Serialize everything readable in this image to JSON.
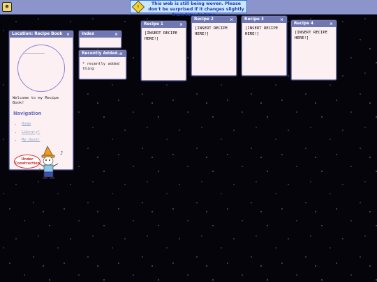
{
  "notice": {
    "icon": "warning-icon",
    "text": "This web is still being woven.  Please don't be surprised if it changes slightly from time to time..."
  },
  "location_window": {
    "title": "Location: Recipe Book",
    "welcome": "Welcome to my Recipe Book!",
    "nav_heading": "Navigation",
    "nav_items": [
      "Home",
      "Library!",
      "My Desk!"
    ],
    "badge_text": "Under Construction"
  },
  "index_window": {
    "title": "Index"
  },
  "recent_window": {
    "title": "Recently Added...",
    "items": [
      "* recently added thing"
    ]
  },
  "recipes": [
    {
      "title": "Recipe 1",
      "text": "[INSERT RECIPE HERE!]"
    },
    {
      "title": "Recipe 2",
      "text": "[INSERT RECIPE HERE!]"
    },
    {
      "title": "Recipe 3",
      "text": "[INSERT RECIPE HERE!]"
    },
    {
      "title": "Recipe 4",
      "text": "[INSERT RECIPE HERE!]"
    }
  ],
  "close_glyph": "×",
  "colors": {
    "window_title": "#6f77b2",
    "window_body": "#fdf0f3",
    "nav_heading": "#6a72b9",
    "link": "#8aa7c8",
    "topbar": "#8b95cc",
    "notice_bg": "#cbe7ff"
  }
}
